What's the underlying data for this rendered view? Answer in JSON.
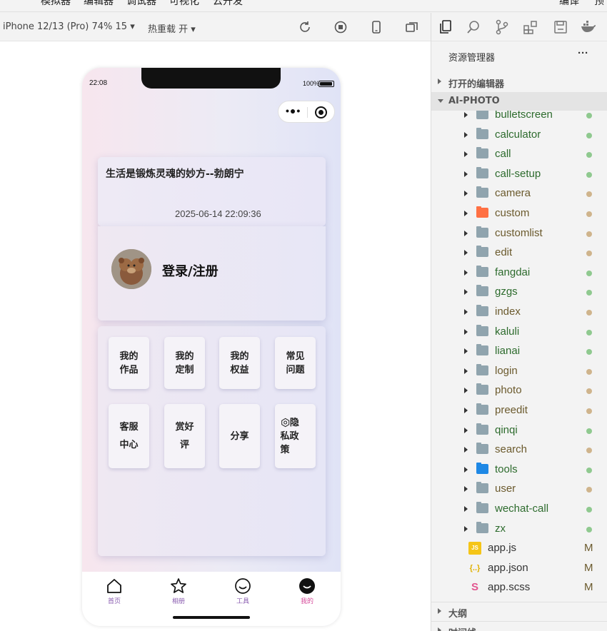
{
  "menubar": [
    "模拟器",
    "编辑器",
    "调试器",
    "可视化",
    "云开发",
    "编译",
    "预"
  ],
  "toolbar": {
    "device": "iPhone 12/13 (Pro) 74% 15 ▾",
    "hot_reload": "热重载 开 ▾"
  },
  "phone": {
    "time": "22:08",
    "battery": "100%",
    "quote": {
      "text": "生活是锻炼灵魂的妙方--勃朗宁",
      "date": "2025-06-14 22:09:36"
    },
    "login_label": "登录/注册",
    "tiles": [
      {
        "l1": "我的",
        "l2": "作品"
      },
      {
        "l1": "我的",
        "l2": "定制"
      },
      {
        "l1": "我的",
        "l2": "权益"
      },
      {
        "l1": "常见",
        "l2": "问题"
      },
      {
        "l1": "客服",
        "l2": "中心"
      },
      {
        "l1": "赏好",
        "l2": "评"
      },
      {
        "l1": "分享",
        "l2": ""
      },
      {
        "l1": "隐",
        "l2": "私政",
        "l3": "策"
      }
    ],
    "tabs": [
      "首页",
      "相册",
      "工具",
      "我的"
    ]
  },
  "explorer": {
    "title": "资源管理器",
    "more": "···",
    "open_editors": "打开的编辑器",
    "project": "AI-PHOTO",
    "folders": [
      {
        "name": "bulletscreen",
        "status": "green",
        "color": "#90a4ae"
      },
      {
        "name": "calculator",
        "status": "green",
        "color": "#90a4ae"
      },
      {
        "name": "call",
        "status": "green",
        "color": "#90a4ae"
      },
      {
        "name": "call-setup",
        "status": "green",
        "color": "#90a4ae"
      },
      {
        "name": "camera",
        "status": "tan",
        "color": "#90a4ae"
      },
      {
        "name": "custom",
        "status": "tan",
        "color": "#ff7043"
      },
      {
        "name": "customlist",
        "status": "tan",
        "color": "#90a4ae"
      },
      {
        "name": "edit",
        "status": "tan",
        "color": "#90a4ae"
      },
      {
        "name": "fangdai",
        "status": "green",
        "color": "#90a4ae"
      },
      {
        "name": "gzgs",
        "status": "green",
        "color": "#90a4ae"
      },
      {
        "name": "index",
        "status": "tan",
        "color": "#90a4ae"
      },
      {
        "name": "kaluli",
        "status": "green",
        "color": "#90a4ae"
      },
      {
        "name": "lianai",
        "status": "green",
        "color": "#90a4ae"
      },
      {
        "name": "login",
        "status": "tan",
        "color": "#90a4ae"
      },
      {
        "name": "photo",
        "status": "tan",
        "color": "#90a4ae"
      },
      {
        "name": "preedit",
        "status": "tan",
        "color": "#90a4ae"
      },
      {
        "name": "qinqi",
        "status": "green",
        "color": "#90a4ae"
      },
      {
        "name": "search",
        "status": "tan",
        "color": "#90a4ae"
      },
      {
        "name": "tools",
        "status": "green",
        "color": "#1e88e5"
      },
      {
        "name": "user",
        "status": "tan",
        "color": "#90a4ae"
      },
      {
        "name": "wechat-call",
        "status": "green",
        "color": "#90a4ae"
      },
      {
        "name": "zx",
        "status": "green",
        "color": "#90a4ae"
      }
    ],
    "files": [
      {
        "name": "app.js",
        "mark": "M",
        "icon": "JS",
        "icon_color": "#f5c518"
      },
      {
        "name": "app.json",
        "mark": "M",
        "icon": "{..}",
        "icon_color": "#e0b000"
      },
      {
        "name": "app.scss",
        "mark": "M",
        "icon": "S",
        "icon_color": "#e2558f"
      }
    ],
    "outline": "大纲",
    "timeline": "时间线"
  },
  "colors": {
    "status_green": "#8fc98f",
    "status_tan": "#cfb48c",
    "tab_label": "#8a5db0",
    "tab_active": "#d64a9a"
  }
}
